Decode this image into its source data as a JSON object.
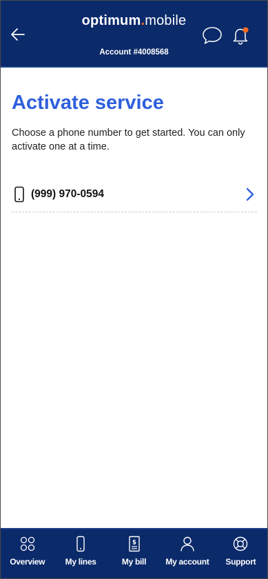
{
  "header": {
    "logo_brand": "optimum",
    "logo_dot": ".",
    "logo_suffix": "mobile",
    "account": "Account #4008568"
  },
  "main": {
    "title": "Activate service",
    "subtitle": "Choose a phone number to get started. You can only activate one at a time.",
    "lines": [
      {
        "number": "(999) 970-0594"
      }
    ]
  },
  "tabbar": {
    "items": [
      {
        "label": "Overview",
        "icon": "overview-icon"
      },
      {
        "label": "My lines",
        "icon": "phone-icon"
      },
      {
        "label": "My bill",
        "icon": "bill-icon"
      },
      {
        "label": "My account",
        "icon": "person-icon"
      },
      {
        "label": "Support",
        "icon": "lifebuoy-icon"
      }
    ]
  },
  "colors": {
    "header_bg": "#0b2a6a",
    "accent": "#2f5fdc",
    "logo_dot": "#f26a21",
    "notification_badge": "#f26a21"
  }
}
